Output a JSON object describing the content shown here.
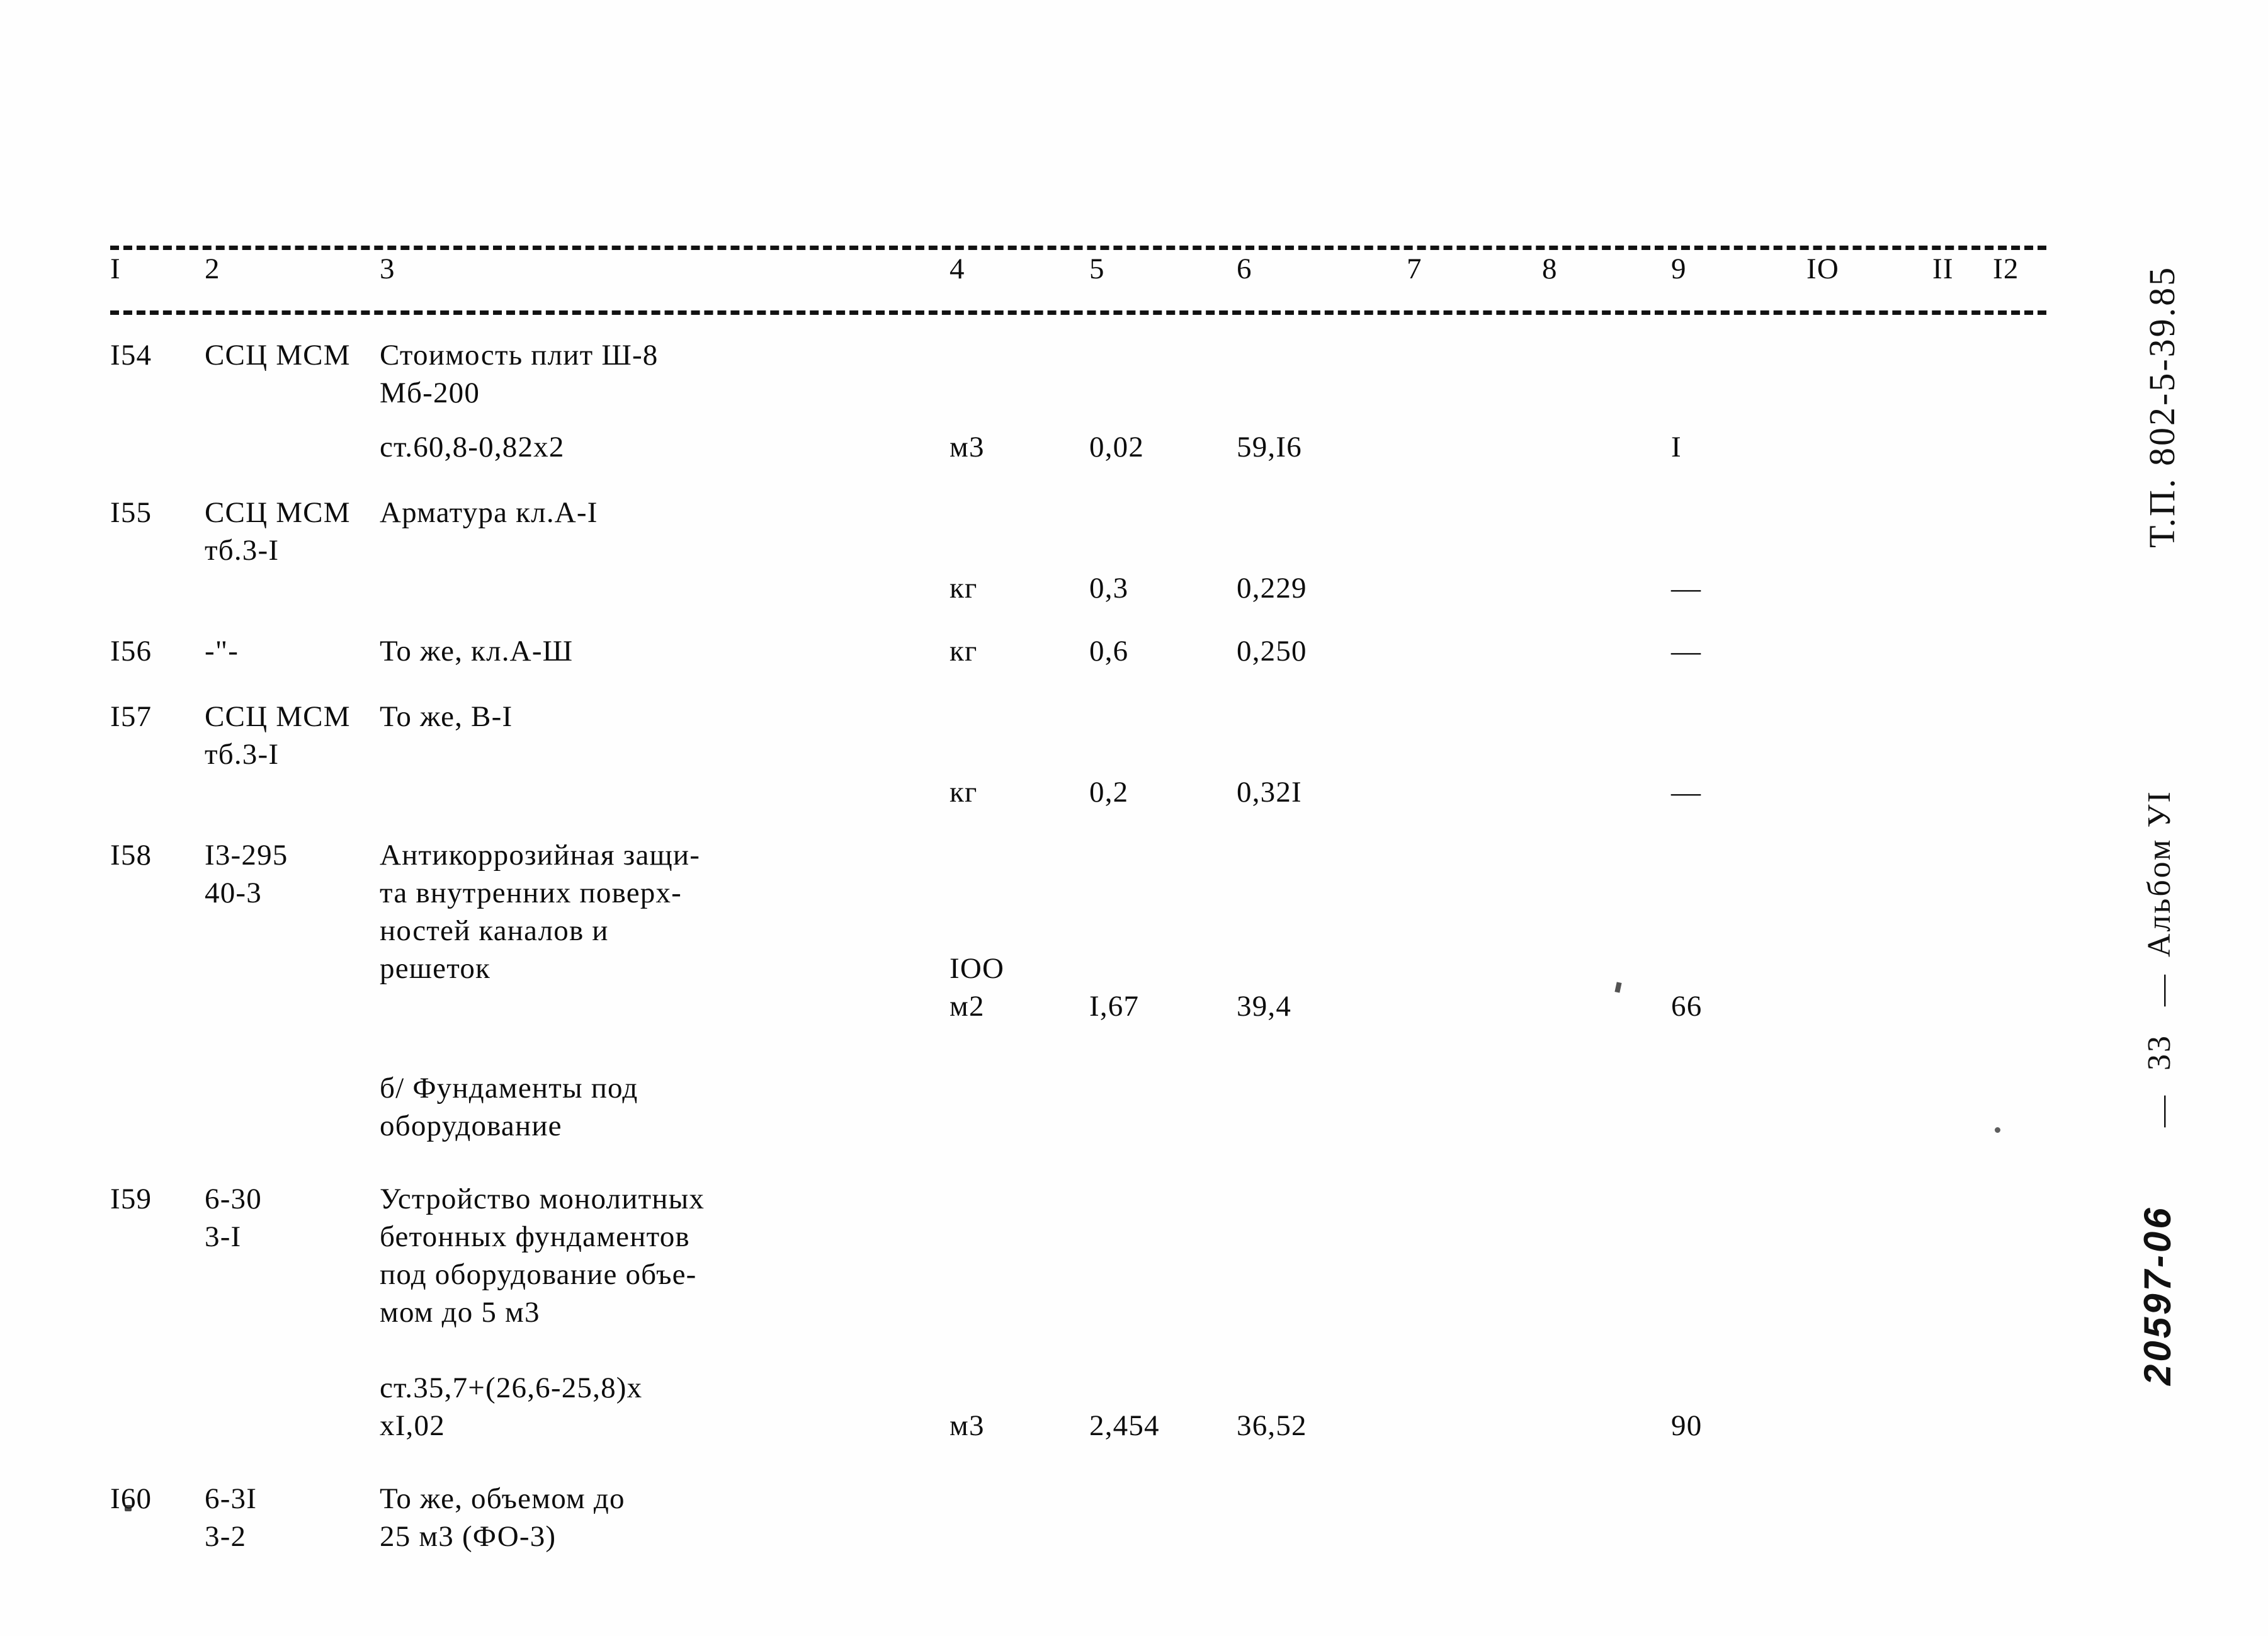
{
  "document": {
    "margin": {
      "type_project": "Т.П. 802-5-39.85",
      "album": "Альбом УI",
      "dash_1": "—",
      "page_number": "33",
      "dash_2": "—",
      "archive_code": "20597-06"
    }
  },
  "table": {
    "column_headers": [
      "I",
      "2",
      "3",
      "4",
      "5",
      "6",
      "7",
      "8",
      "9",
      "IO",
      "II",
      "I2"
    ],
    "rows": [
      {
        "n": "I54",
        "code": "ССЦ МСМ",
        "desc": "Стоимость плит Ш-8\nМб-200",
        "desc2": "ст.60,8-0,82х2",
        "unit": "м3",
        "c5": "0,02",
        "c6": "59,I6",
        "c7": "",
        "c8": "",
        "c9": "I",
        "c10": "",
        "c11": "",
        "c12": ""
      },
      {
        "n": "I55",
        "code": "ССЦ МСМ\nтб.3-I",
        "desc": "Арматура кл.А-I",
        "desc2": "",
        "unit": "кг",
        "c5": "0,3",
        "c6": "0,229",
        "c7": "",
        "c8": "",
        "c9": "—",
        "c10": "",
        "c11": "",
        "c12": ""
      },
      {
        "n": "I56",
        "code": "-\"-",
        "desc": "То же, кл.А-Ш",
        "desc2": "",
        "unit": "кг",
        "c5": "0,6",
        "c6": "0,250",
        "c7": "",
        "c8": "",
        "c9": "—",
        "c10": "",
        "c11": "",
        "c12": ""
      },
      {
        "n": "I57",
        "code": "ССЦ МСМ\nтб.3-I",
        "desc": "То же, В-I",
        "desc2": "",
        "unit": "кг",
        "c5": "0,2",
        "c6": "0,32I",
        "c7": "",
        "c8": "",
        "c9": "—",
        "c10": "",
        "c11": "",
        "c12": ""
      },
      {
        "n": "I58",
        "code": "I3-295\n40-3",
        "desc": "Антикоррозийная защи-\nта внутренних поверх-\nностей каналов и\nрешеток",
        "desc2": "",
        "unit": "IOO\nм2",
        "c5": "I,67",
        "c6": "39,4",
        "c7": "",
        "c8": "",
        "c9": "66",
        "c10": "",
        "c11": "",
        "c12": ""
      },
      {
        "n": "",
        "code": "",
        "desc": "б/ Фундаменты под\n    оборудование",
        "desc2": "",
        "unit": "",
        "c5": "",
        "c6": "",
        "c7": "",
        "c8": "",
        "c9": "",
        "c10": "",
        "c11": "",
        "c12": ""
      },
      {
        "n": "I59",
        "code": "6-30\n3-I",
        "desc": "Устройство монолитных\nбетонных фундаментов\nпод оборудование объе-\nмом до 5 м3",
        "desc2": "ст.35,7+(26,6-25,8)х\nхI,02",
        "unit": "м3",
        "c5": "2,454",
        "c6": "36,52",
        "c7": "",
        "c8": "",
        "c9": "90",
        "c10": "",
        "c11": "",
        "c12": ""
      },
      {
        "n": "I60",
        "code": "6-3I\n3-2",
        "desc": "То же, объемом до\n25 м3 (ФО-3)",
        "desc2": "",
        "unit": "",
        "c5": "",
        "c6": "",
        "c7": "",
        "c8": "",
        "c9": "",
        "c10": "",
        "c11": "",
        "c12": ""
      }
    ]
  }
}
